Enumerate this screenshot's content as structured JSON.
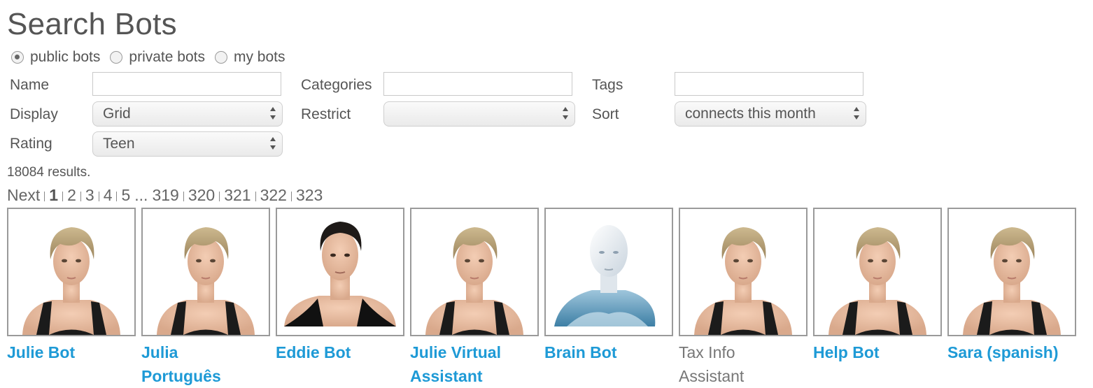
{
  "page": {
    "title": "Search Bots"
  },
  "filters": {
    "scope_options": [
      {
        "label": "public bots",
        "checked": true
      },
      {
        "label": "private bots",
        "checked": false
      },
      {
        "label": "my bots",
        "checked": false
      }
    ],
    "name_label": "Name",
    "name_value": "",
    "categories_label": "Categories",
    "categories_value": "",
    "tags_label": "Tags",
    "tags_value": "",
    "display_label": "Display",
    "display_value": "Grid",
    "restrict_label": "Restrict",
    "restrict_value": "",
    "sort_label": "Sort",
    "sort_value": "connects this month",
    "rating_label": "Rating",
    "rating_value": "Teen"
  },
  "results": {
    "text": "18084 results."
  },
  "pagination": {
    "next_label": "Next",
    "pages": [
      "1",
      "2",
      "3",
      "4",
      "5"
    ],
    "current": "1",
    "ellipsis": "...",
    "tail_pages": [
      "319",
      "320",
      "321",
      "322",
      "323"
    ]
  },
  "bots": [
    {
      "name": "Julie Bot",
      "avatar": "blonde-woman-avatar",
      "linked": true
    },
    {
      "name": "Julia Português",
      "avatar": "blonde-woman-avatar",
      "linked": true
    },
    {
      "name": "Eddie Bot",
      "avatar": "dark-haired-man-avatar",
      "linked": true
    },
    {
      "name": "Julie Virtual Assistant",
      "avatar": "blonde-woman-avatar",
      "linked": true
    },
    {
      "name": "Brain Bot",
      "avatar": "white-robot-avatar",
      "linked": true
    },
    {
      "name": "Tax Info Assistant",
      "avatar": "blonde-woman-avatar",
      "linked": false
    },
    {
      "name": "Help Bot",
      "avatar": "blonde-woman-avatar",
      "linked": true
    },
    {
      "name": "Sara (spanish)",
      "avatar": "blonde-woman-avatar",
      "linked": true
    }
  ],
  "colors": {
    "link": "#1e9ad6",
    "text": "#555555",
    "border": "#9a9a9a"
  }
}
